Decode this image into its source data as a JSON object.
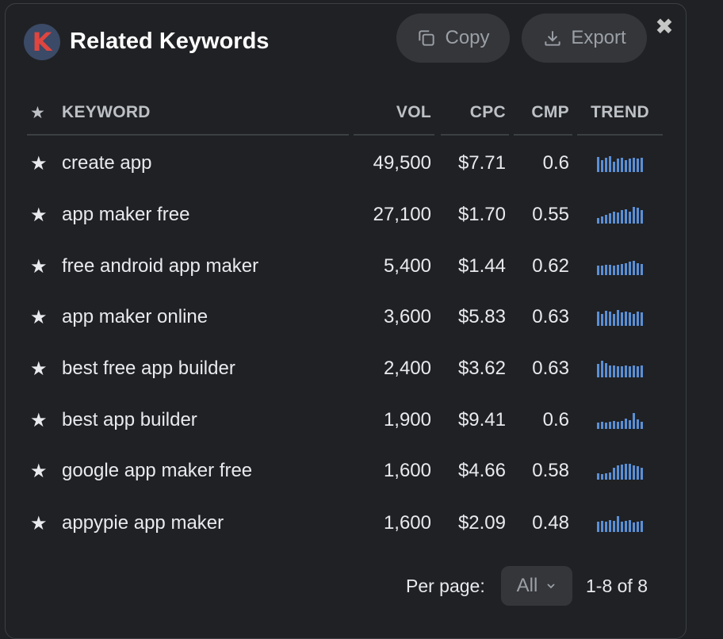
{
  "header": {
    "logo_letter": "K",
    "title": "Related Keywords",
    "copy_label": "Copy",
    "export_label": "Export",
    "close_glyph": "✖",
    "icons": {
      "copy": "copy-icon",
      "export": "download-icon",
      "close": "close-icon"
    }
  },
  "table": {
    "columns": {
      "star": "★",
      "keyword": "KEYWORD",
      "vol": "VOL",
      "cpc": "CPC",
      "cmp": "CMP",
      "trend": "TREND"
    },
    "rows": [
      {
        "star": "★",
        "keyword": "create app",
        "vol": "49,500",
        "cpc": "$7.71",
        "cmp": "0.6",
        "trend": [
          0.85,
          0.7,
          0.8,
          0.9,
          0.6,
          0.75,
          0.8,
          0.7,
          0.75,
          0.8,
          0.75,
          0.8
        ]
      },
      {
        "star": "★",
        "keyword": "app maker free",
        "vol": "27,100",
        "cpc": "$1.70",
        "cmp": "0.55",
        "trend": [
          0.3,
          0.4,
          0.5,
          0.6,
          0.7,
          0.65,
          0.75,
          0.8,
          0.7,
          0.95,
          0.9,
          0.75
        ]
      },
      {
        "star": "★",
        "keyword": "free android app maker",
        "vol": "5,400",
        "cpc": "$1.44",
        "cmp": "0.62",
        "trend": [
          0.55,
          0.55,
          0.6,
          0.6,
          0.55,
          0.6,
          0.65,
          0.7,
          0.75,
          0.8,
          0.7,
          0.65
        ]
      },
      {
        "star": "★",
        "keyword": "app maker online",
        "vol": "3,600",
        "cpc": "$5.83",
        "cmp": "0.63",
        "trend": [
          0.8,
          0.7,
          0.85,
          0.8,
          0.7,
          0.9,
          0.75,
          0.8,
          0.75,
          0.7,
          0.8,
          0.75
        ]
      },
      {
        "star": "★",
        "keyword": "best free app builder",
        "vol": "2,400",
        "cpc": "$3.62",
        "cmp": "0.63",
        "trend": [
          0.75,
          0.95,
          0.8,
          0.7,
          0.7,
          0.65,
          0.65,
          0.7,
          0.65,
          0.7,
          0.65,
          0.7
        ]
      },
      {
        "star": "★",
        "keyword": "best app builder",
        "vol": "1,900",
        "cpc": "$9.41",
        "cmp": "0.6",
        "trend": [
          0.35,
          0.4,
          0.35,
          0.4,
          0.45,
          0.4,
          0.45,
          0.6,
          0.5,
          0.9,
          0.55,
          0.4
        ]
      },
      {
        "star": "★",
        "keyword": "google app maker free",
        "vol": "1,600",
        "cpc": "$4.66",
        "cmp": "0.58",
        "trend": [
          0.35,
          0.3,
          0.35,
          0.4,
          0.7,
          0.8,
          0.85,
          0.9,
          0.9,
          0.8,
          0.75,
          0.7
        ]
      },
      {
        "star": "★",
        "keyword": "appypie app maker",
        "vol": "1,600",
        "cpc": "$2.09",
        "cmp": "0.48",
        "trend": [
          0.6,
          0.65,
          0.6,
          0.7,
          0.65,
          0.9,
          0.6,
          0.65,
          0.7,
          0.55,
          0.6,
          0.65
        ]
      }
    ]
  },
  "pagination": {
    "per_page_label": "Per page:",
    "per_page_value": "All",
    "range_text": "1-8 of 8"
  },
  "colors": {
    "background": "#202124",
    "button": "#35363a",
    "trend_bar": "#5b8fd6",
    "logo_bg": "#3b4a66",
    "logo_letter": "#e0453f"
  }
}
